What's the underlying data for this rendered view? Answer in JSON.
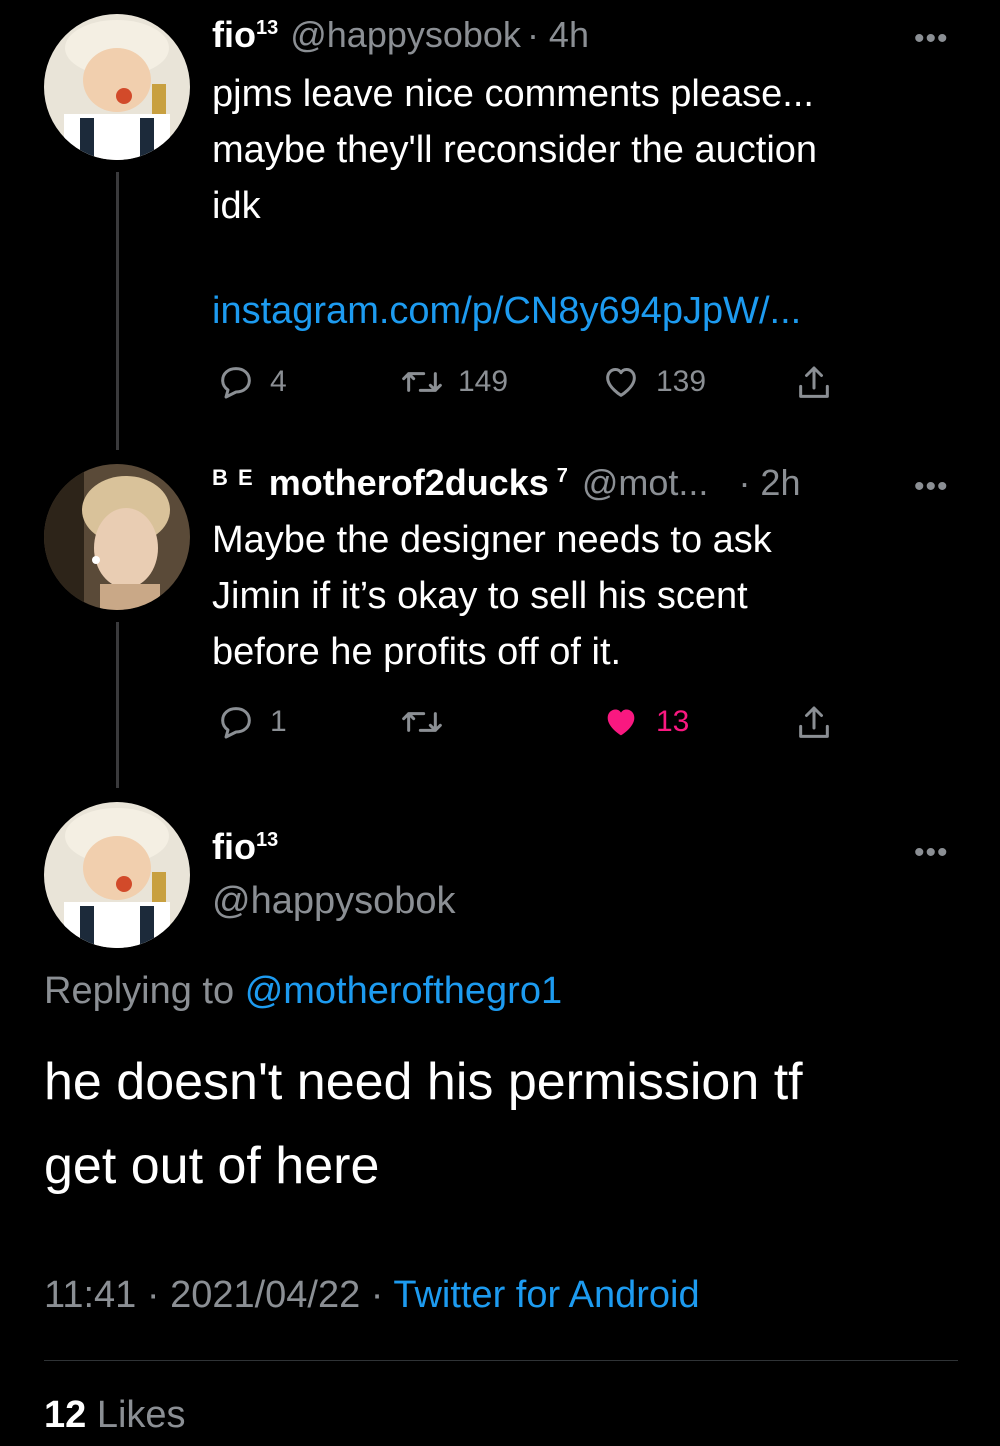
{
  "tweet1": {
    "display_name": "fio",
    "name_sup": "13",
    "handle": "@happysobok",
    "time": "· 4h",
    "more": "•••",
    "text_lines": [
      "pjms leave nice comments please...",
      "maybe they'll reconsider the auction",
      "idk"
    ],
    "link": "instagram.com/p/CN8y694pJpW/...",
    "replies": "4",
    "retweets": "149",
    "likes": "139"
  },
  "tweet2": {
    "prefix": "B E",
    "display_name": "motherof2ducks",
    "name_sup": "7",
    "handle": "@mot...",
    "time": "· 2h",
    "more": "•••",
    "text_lines": [
      "Maybe the designer needs to ask",
      "Jimin if it’s okay to sell his scent",
      "before he profits off of it."
    ],
    "replies": "1",
    "likes": "13",
    "like_color": "#f91880"
  },
  "main_tweet": {
    "display_name": "fio",
    "name_sup": "13",
    "handle": "@happysobok",
    "more": "•••",
    "replying_label": "Replying to",
    "replying_handle": "@motherofthegro1",
    "text_lines": [
      "he doesn't need his permission tf",
      "get out of here"
    ],
    "time": "11:41",
    "date": "2021/04/22",
    "source": "Twitter for Android",
    "likes_count": "12",
    "likes_label": "Likes"
  },
  "icons": [
    "reply-icon",
    "retweet-icon",
    "heart-icon",
    "share-icon"
  ],
  "colors": {
    "background": "#000000",
    "link": "#1d9bf0",
    "secondary": "#8b8f94",
    "liked": "#f91880"
  }
}
